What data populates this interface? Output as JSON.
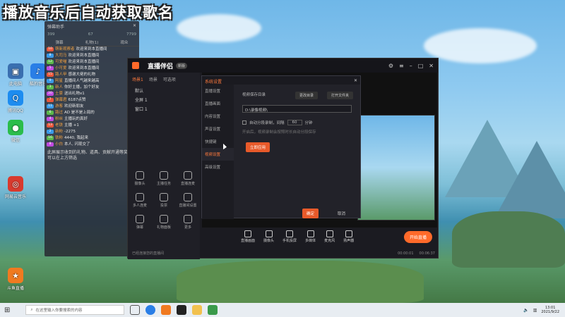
{
  "overlay_title": "播放音乐后自动获取歌名",
  "desktop_icons": [
    {
      "label": "腾讯QQ",
      "icon": "qq-icon",
      "color": "#1d8cf0"
    },
    {
      "label": "酷狗音乐",
      "icon": "music-icon",
      "color": "#2a7ee6"
    },
    {
      "label": "微信",
      "icon": "wechat-icon",
      "color": "#2bbd4b"
    },
    {
      "label": "网易云音乐",
      "icon": "netease-icon",
      "color": "#d83a2e"
    },
    {
      "label": "斗鱼直播",
      "icon": "game-icon",
      "color": "#f07a20"
    }
  ],
  "chat": {
    "title": "弹幕助手",
    "stats": [
      "399",
      "67",
      "7799"
    ],
    "tabs": [
      "弹幕",
      "礼物(1)",
      "观众"
    ],
    "messages": [
      {
        "level": "10",
        "name": "萌新观察者",
        "text": "欢迎来到本直播间"
      },
      {
        "level": "8",
        "name": "大司马",
        "text": "欢迎来到本直播间"
      },
      {
        "level": "12",
        "name": "可爱喵",
        "text": "欢迎来到本直播间"
      },
      {
        "level": "5",
        "name": "小可爱",
        "text": "欢迎来到本直播间"
      },
      {
        "level": "15",
        "name": "路人甲",
        "text": "感谢大佬的礼物"
      },
      {
        "level": "9",
        "name": "阿星",
        "text": "直播间人气越来越高"
      },
      {
        "level": "3",
        "name": "新人",
        "text": "你好主播，加个好友"
      },
      {
        "level": "20",
        "name": "土豪",
        "text": "送出礼物x1"
      },
      {
        "level": "7",
        "name": "弹幕君",
        "text": "6187点赞"
      },
      {
        "level": "11",
        "name": "游客",
        "text": "欢迎新朋友"
      },
      {
        "level": "6",
        "name": "路过",
        "text": "AD 是不是上局的"
      },
      {
        "level": "4",
        "name": "粉丝",
        "text": "主播玩的真好"
      },
      {
        "level": "13",
        "name": "老铁",
        "text": "主播 +1"
      },
      {
        "level": "2",
        "name": "新粉",
        "text": "-2275"
      },
      {
        "level": "16",
        "name": "铁粉",
        "text": "4440, 我起来"
      },
      {
        "level": "8",
        "name": "小白",
        "text": "本人, 闪现交了"
      }
    ],
    "notice": "此屏展示收到的礼物、道具、贡献开通等奖励，可以在上方筛选"
  },
  "app": {
    "name": "直播伴侣",
    "version": "新版",
    "scene_tabs": [
      "场景1",
      "场景",
      "可选项"
    ],
    "scenes": [
      "默认",
      "全屏 1",
      "窗口 1"
    ],
    "tools": [
      "摄像头",
      "主播任务",
      "直播连麦",
      "多人连麦",
      "投票",
      "直播间设置",
      "弹幕",
      "礼物面板",
      "更多"
    ],
    "bottom_tools": [
      "直播画面",
      "摄像头",
      "手机投屏",
      "多媒体",
      "麦克风",
      "扬声器"
    ],
    "start_button": "开始直播",
    "status_text": "已经连接您的直播间",
    "timer_1": "00:00:01",
    "timer_2": "00:06:37"
  },
  "settings": {
    "title": "系统设置",
    "menu": [
      "直播设置",
      "直播画面",
      "内容设置",
      "声音设置",
      "快捷键",
      "视频设置",
      "高级设置"
    ],
    "selected": "视频设置",
    "section_label": "视频保存目录",
    "change_dir": "更改目录",
    "open_folder": "打开文件夹",
    "path": "D:\\录像视频\\",
    "option_label": "自动分段录制，间隔",
    "option_value": "60",
    "option_unit": "分钟",
    "hint": "开启后，视频录制会按照时长自动分段保存",
    "apply": "立即应用",
    "ok": "确定",
    "cancel": "取消"
  },
  "taskbar": {
    "search_placeholder": "在这里输入你要搜索的内容",
    "time": "13:01",
    "date": "2021/9/22"
  }
}
